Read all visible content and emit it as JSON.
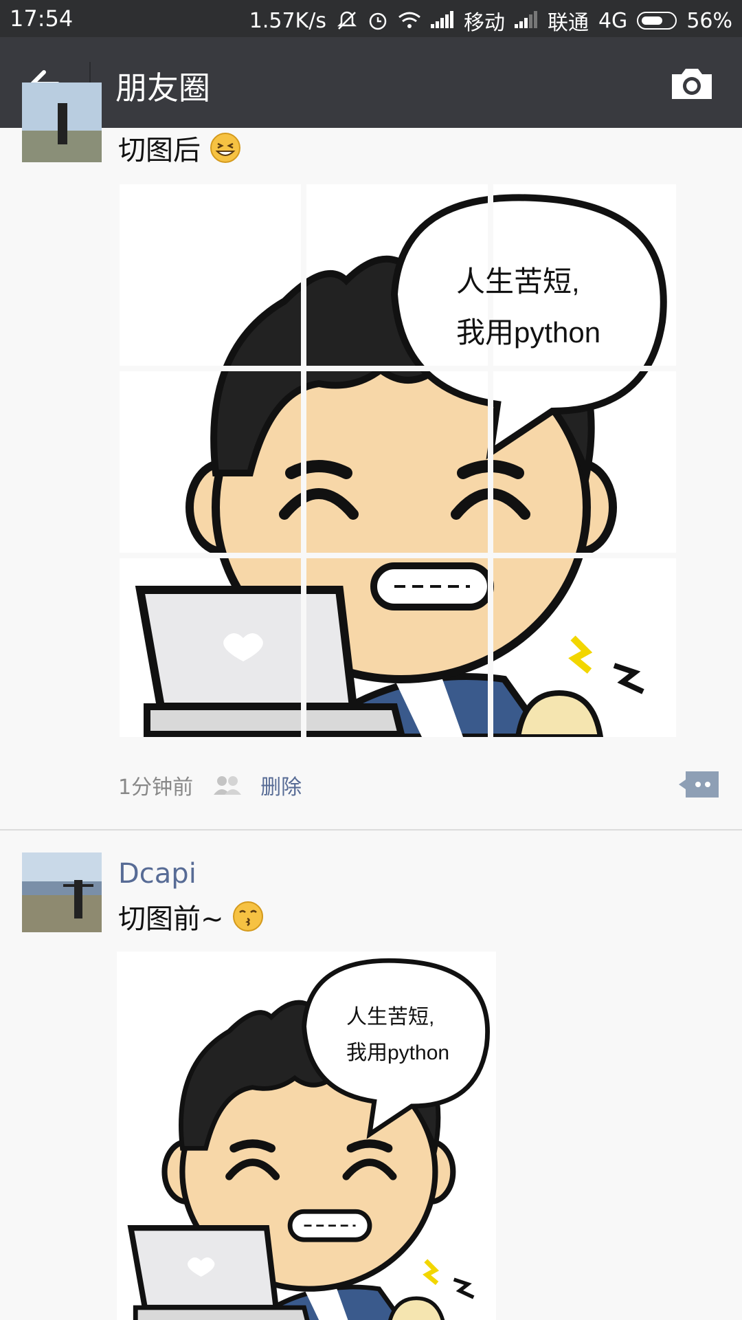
{
  "status_bar": {
    "time": "17:54",
    "speed": "1.57K/s",
    "carrier1": "移动",
    "carrier2": "联通",
    "network": "4G",
    "battery": "56%"
  },
  "nav": {
    "title": "朋友圈"
  },
  "moment1": {
    "text": "切图后",
    "time": "1分钟前",
    "delete": "删除"
  },
  "moment2": {
    "user": "Dcapi",
    "text": "切图前~"
  },
  "bubble": {
    "line1": "人生苦短,",
    "line2": "我用python"
  }
}
